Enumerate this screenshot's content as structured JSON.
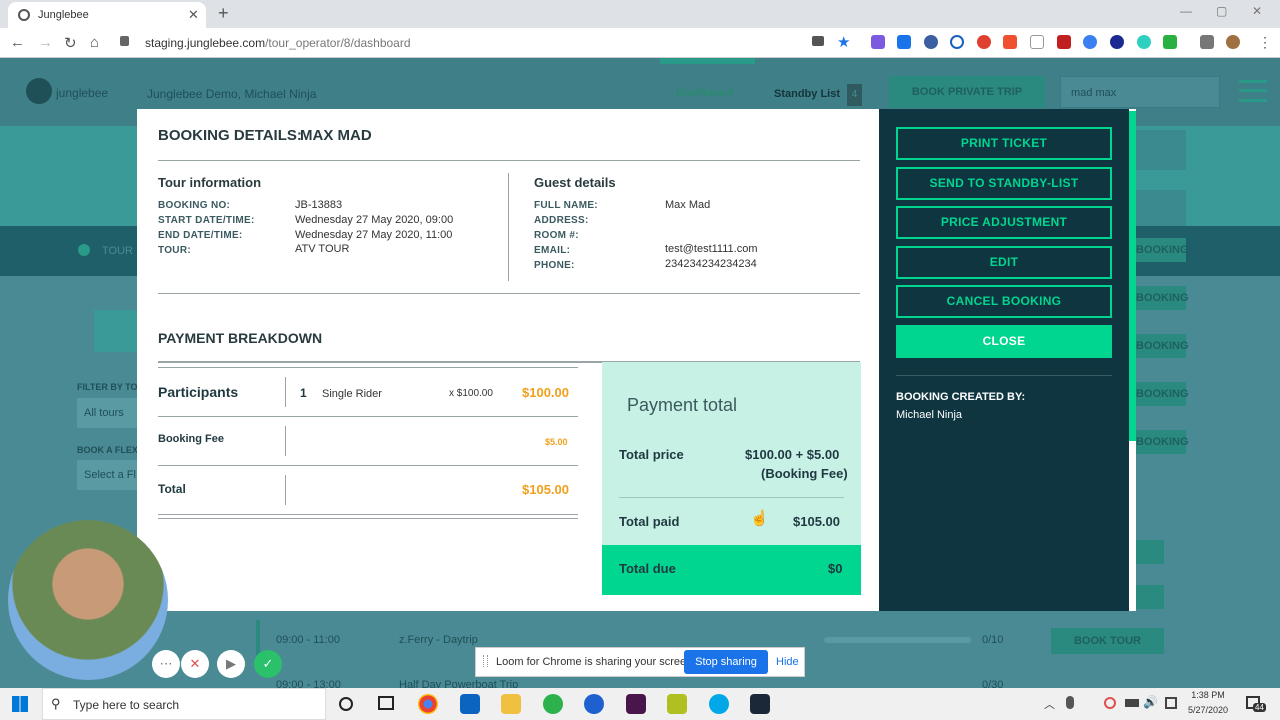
{
  "browser": {
    "tab_title": "Junglebee",
    "url_host": "staging.junglebee.com",
    "url_path": "/tour_operator/8/dashboard"
  },
  "app_bg": {
    "brand": "junglebee",
    "operator": "Junglebee Demo, Michael Ninja",
    "nav_dashboard": "Dashboard",
    "nav_standby": "Standby List",
    "standby_count": "4",
    "book_private": "BOOK PRIVATE TRIP",
    "search_value": "mad max",
    "tour_label": "TOUR",
    "filter_label": "FILTER BY TO",
    "filter_value": "All tours",
    "flex_label": "BOOK A FLEX",
    "flex_value": "Select a Fl",
    "rows": [
      {
        "time": "09:00 - 11:00",
        "name": "z.Ferry - Daytrip",
        "count": "0/10",
        "button": "BOOK TOUR"
      },
      {
        "time": "09:00 - 13:00",
        "name": "Half Day Powerboat Trip",
        "count": "0/30",
        "button": "BOOK TOUR"
      }
    ],
    "side_booking": "BOOKING"
  },
  "modal": {
    "heading_prefix": "BOOKING DETAILS:",
    "heading_name": "MAX MAD",
    "tour_info": {
      "title": "Tour information",
      "booking_no_label": "BOOKING NO:",
      "booking_no": "JB-13883",
      "start_label": "START DATE/TIME:",
      "start": "Wednesday 27 May 2020, 09:00",
      "end_label": "END DATE/TIME:",
      "end": "Wednesday 27 May 2020, 11:00",
      "tour_label": "TOUR:",
      "tour": "ATV TOUR"
    },
    "guest": {
      "title": "Guest details",
      "full_name_label": "FULL NAME:",
      "full_name": "Max Mad",
      "address_label": "ADDRESS:",
      "room_label": "ROOM #:",
      "email_label": "EMAIL:",
      "email": "test@test1111.com",
      "phone_label": "PHONE:",
      "phone": "234234234234234"
    },
    "payment": {
      "title": "PAYMENT BREAKDOWN",
      "participants_label": "Participants",
      "participants_qty": "1",
      "participants_item": "Single Rider",
      "participants_unit": "x  $100.00",
      "participants_amount": "$100.00",
      "fee_label": "Booking Fee",
      "fee_amount": "$5.00",
      "total_label": "Total",
      "total_amount": "$105.00",
      "box_title": "Payment total",
      "total_price_label": "Total price",
      "total_price_value": "$100.00 + $5.00",
      "total_price_note": "(Booking Fee)",
      "total_paid_label": "Total paid",
      "total_paid_value": "$105.00",
      "total_due_label": "Total due",
      "total_due_value": "$0"
    }
  },
  "sidebar": {
    "buttons": [
      "PRINT TICKET",
      "SEND TO STANDBY-LIST",
      "PRICE ADJUSTMENT",
      "EDIT",
      "CANCEL BOOKING"
    ],
    "close_label": "CLOSE",
    "created_by_label": "BOOKING CREATED BY:",
    "created_by": "Michael Ninja"
  },
  "loom": {
    "message": "Loom for Chrome is sharing your screen.",
    "stop": "Stop sharing",
    "hide": "Hide"
  },
  "taskbar": {
    "search_placeholder": "Type here to search",
    "time": "1:38 PM",
    "date": "5/27/2020",
    "notif_count": "44"
  },
  "colors": {
    "accent": "#00d68f",
    "sidebar_bg": "#0f3540",
    "price_orange": "#f0a01c"
  }
}
